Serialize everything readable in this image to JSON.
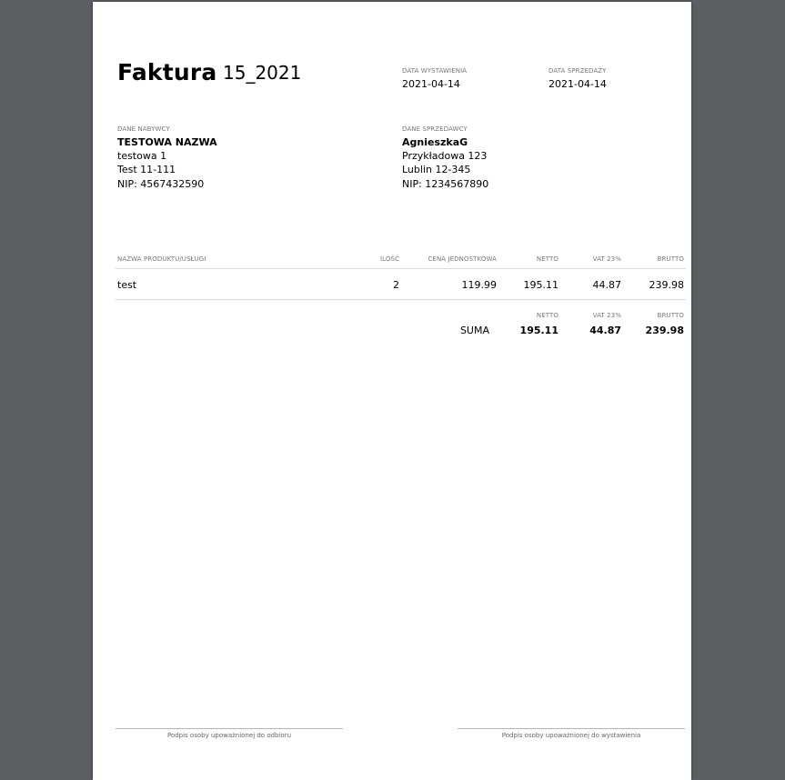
{
  "invoice": {
    "title": "Faktura",
    "number": "15_2021"
  },
  "dates": {
    "issue_label": "DATA WYSTAWIENIA",
    "issue_value": "2021-04-14",
    "sale_label": "DATA SPRZEDAŻY",
    "sale_value": "2021-04-14"
  },
  "buyer": {
    "label": "DANE NABYWCY",
    "name": "TESTOWA NAZWA",
    "street": "testowa 1",
    "city": "Test 11-111",
    "nip": "NIP: 4567432590"
  },
  "seller": {
    "label": "DANE SPRZEDAWCY",
    "name": "AgnieszkaG",
    "street": "Przykładowa 123",
    "city": "Lublin 12-345",
    "nip": "NIP: 1234567890"
  },
  "table": {
    "headers": {
      "name": "NAZWA PRODUKTU/USŁUGI",
      "qty": "ILOŚĆ",
      "unit_price": "CENA JEDNOSTKOWA",
      "net": "NETTO",
      "vat": "VAT 23%",
      "gross": "BRUTTO"
    },
    "rows": [
      {
        "name": "test",
        "qty": "2",
        "unit_price": "119.99",
        "net": "195.11",
        "vat": "44.87",
        "gross": "239.98"
      }
    ]
  },
  "totals": {
    "net_label": "NETTO",
    "vat_label": "VAT 23%",
    "gross_label": "BRUTTO",
    "sum_label": "SUMA",
    "net": "195.11",
    "vat": "44.87",
    "gross": "239.98"
  },
  "signatures": {
    "receiver": "Podpis osoby upoważnionej do odbioru",
    "issuer": "Podpis osoby upoważnionej do wystawienia"
  }
}
